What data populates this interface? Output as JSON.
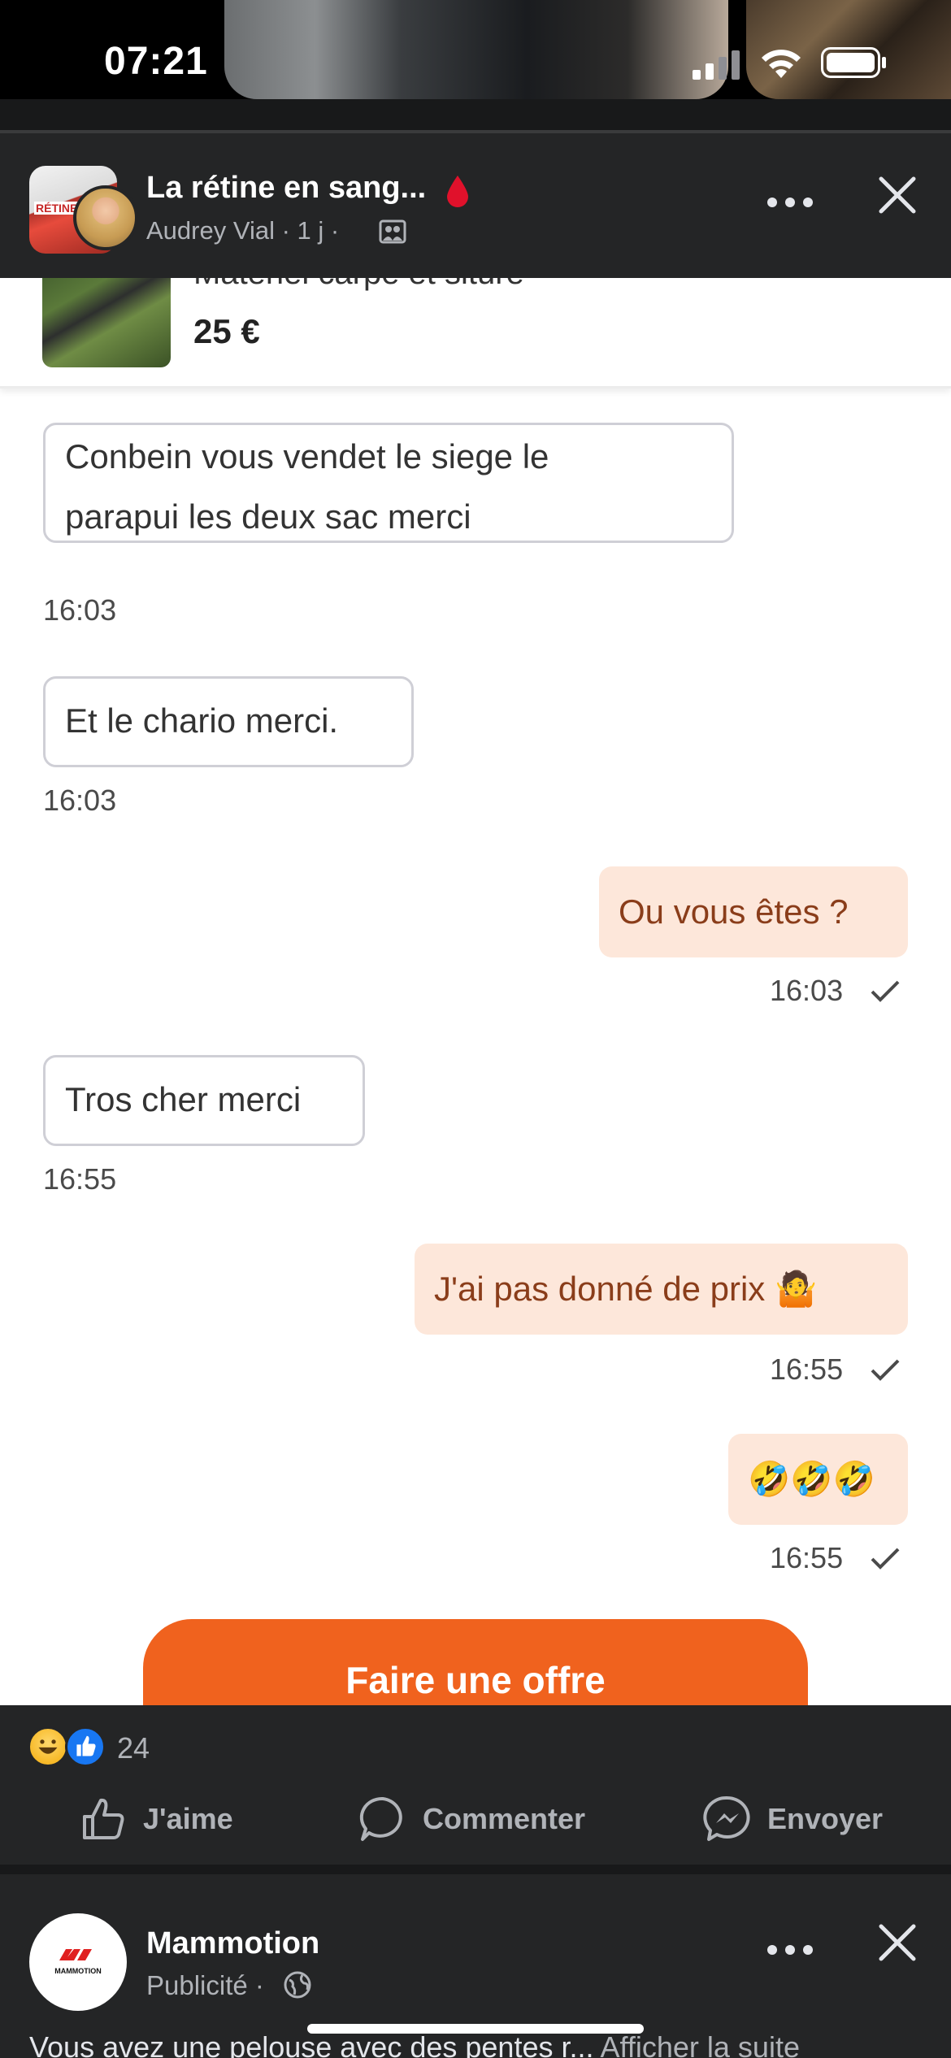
{
  "status_bar": {
    "time": "07:21"
  },
  "post": {
    "title": "La rétine en sang...",
    "author": "Audrey Vial",
    "meta_separator": "·",
    "age": "1 j",
    "thumb_text": "RÉTINE",
    "screenshot": {
      "listing": {
        "title": "Matériel carpe et siture",
        "price": "25 €"
      },
      "messages": [
        {
          "dir": "in",
          "lines": [
            "Conbein vous vendet le siege le",
            "parapui les deux sac merci"
          ],
          "time": "16:03"
        },
        {
          "dir": "in",
          "lines": [
            "Et le chario merci."
          ],
          "time": "16:03"
        },
        {
          "dir": "out",
          "lines": [
            "Ou vous êtes ?"
          ],
          "time": "16:03"
        },
        {
          "dir": "in",
          "lines": [
            "Tros cher merci"
          ],
          "time": "16:55"
        },
        {
          "dir": "out",
          "lines": [
            "J'ai pas donné de prix 🤷"
          ],
          "time": "16:55"
        },
        {
          "dir": "out",
          "lines": [
            "🤣🤣🤣"
          ],
          "time": "16:55"
        }
      ],
      "offer_button": "Faire une offre"
    },
    "reactions": {
      "count": "24"
    },
    "actions": {
      "like": "J'aime",
      "comment": "Commenter",
      "send": "Envoyer"
    }
  },
  "next_post": {
    "name": "Mammotion",
    "meta": "Publicité ·",
    "logo_text": "MAMMOTION",
    "text": "Vous avez une pelouse avec des pentes r...",
    "more_link": "Afficher la suite"
  },
  "colors": {
    "background": "#242526",
    "incoming_bubble_border": "#cfcfd6",
    "outgoing_bubble": "#fde7da",
    "offer_button": "#f0621e",
    "like_blue": "#1877f2"
  }
}
